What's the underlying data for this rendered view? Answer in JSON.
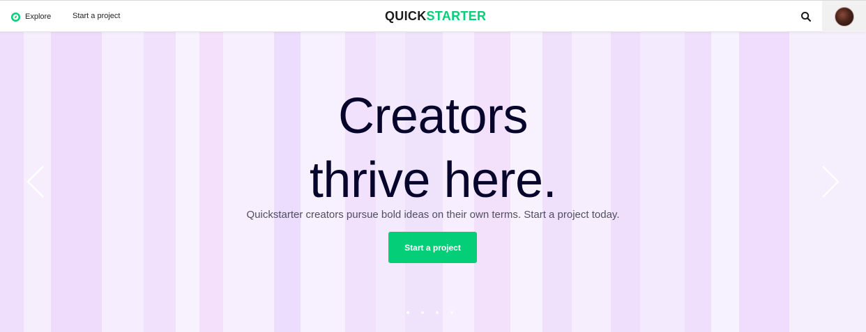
{
  "header": {
    "explore_label": "Explore",
    "start_label": "Start a project",
    "logo_part1": "QUICK",
    "logo_part2": "STARTER",
    "brand_color": "#05ce78",
    "icons": [
      "explore-compass-icon",
      "search-icon"
    ]
  },
  "hero": {
    "title_line1": "Creators",
    "title_line2": "thrive here.",
    "subtitle": "Quickstarter creators pursue bold ideas on their own terms. Start a project today.",
    "cta_label": "Start a project",
    "slides": 4,
    "current_slide": 1,
    "stripe_colors": [
      "#f0defd",
      "#f6eefd",
      "#efdcfd",
      "#f6eefe",
      "#f2e1fc",
      "#f8f2fe",
      "#f4e0fb",
      "#f7effd",
      "#ecdcfe",
      "#f7f0fe",
      "#f1e1fc",
      "#f4eafd",
      "#efe2fb",
      "#f7efff",
      "#f3e1fb",
      "#f8f1fe",
      "#efe0fc",
      "#f6eefd",
      "#efdffc",
      "#f4eafe",
      "#efdffc",
      "#f7f2ff",
      "#f0ddfd"
    ]
  }
}
